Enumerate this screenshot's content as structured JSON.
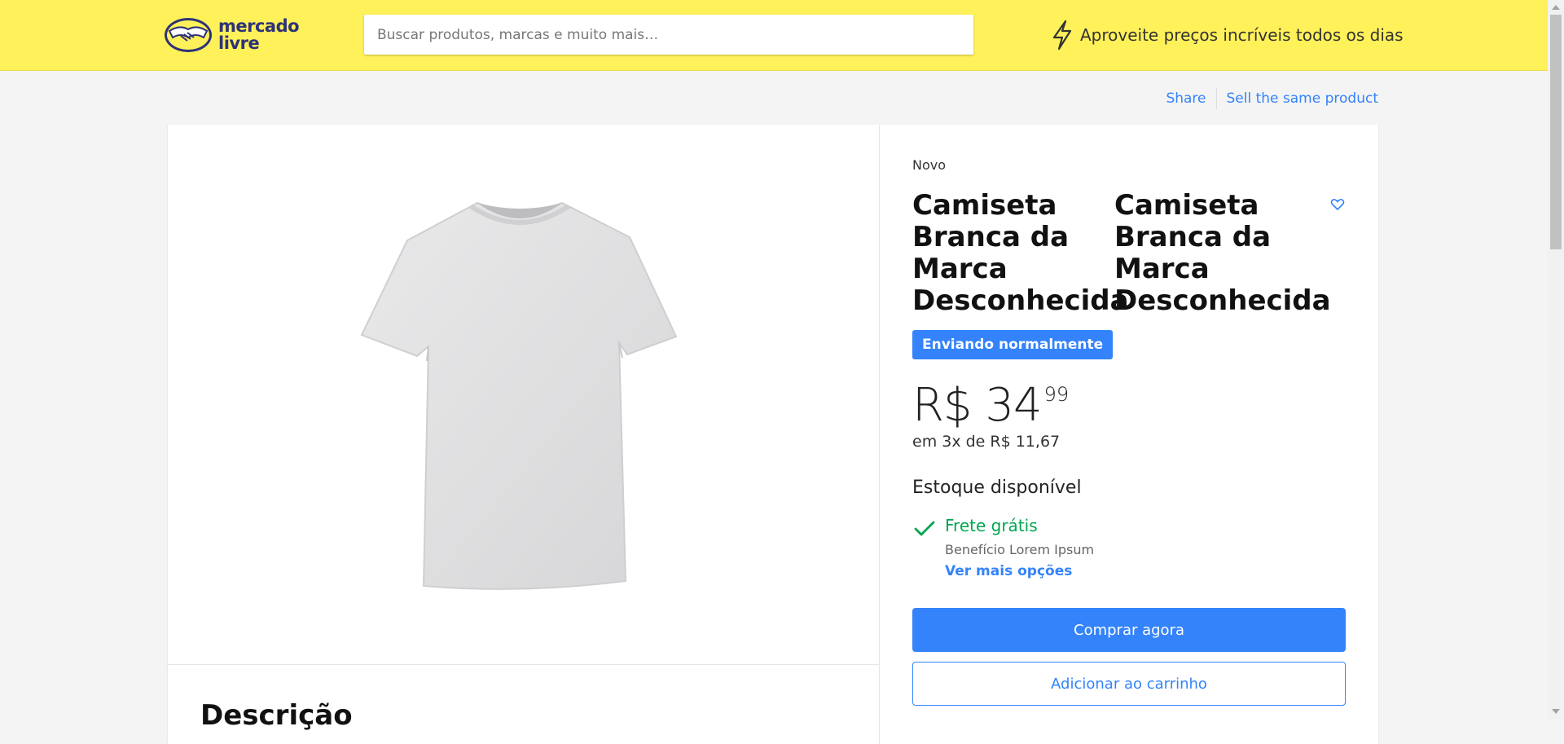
{
  "header": {
    "logo_text_line1": "mercado",
    "logo_text_line2": "livre",
    "search_placeholder": "Buscar produtos, marcas e muito mais…",
    "promo_text": "Aproveite preços incríveis todos os dias",
    "promo_icon": "lightning-icon",
    "background_color": "#fff159"
  },
  "top_links": {
    "share": "Share",
    "sell": "Sell the same product"
  },
  "product": {
    "condition": "Novo",
    "title_left": "Camiseta Branca da Marca Desconhecida",
    "title_right": "Camiseta Branca da Marca Desconhecida",
    "badge": "Enviando normalmente",
    "price_main": "R$ 34",
    "price_cents": "99",
    "installments": "em 3x de R$ 11,67",
    "stock": "Estoque disponível",
    "shipping_title": "Frete grátis",
    "shipping_subtitle": "Benefício Lorem Ipsum",
    "shipping_more": "Ver mais opções",
    "buy_button": "Comprar agora",
    "cart_button": "Adicionar ao carrinho",
    "description_heading": "Descrição",
    "image_icon": "tshirt-image",
    "accent_color": "#3483fa",
    "success_color": "#00a650"
  }
}
